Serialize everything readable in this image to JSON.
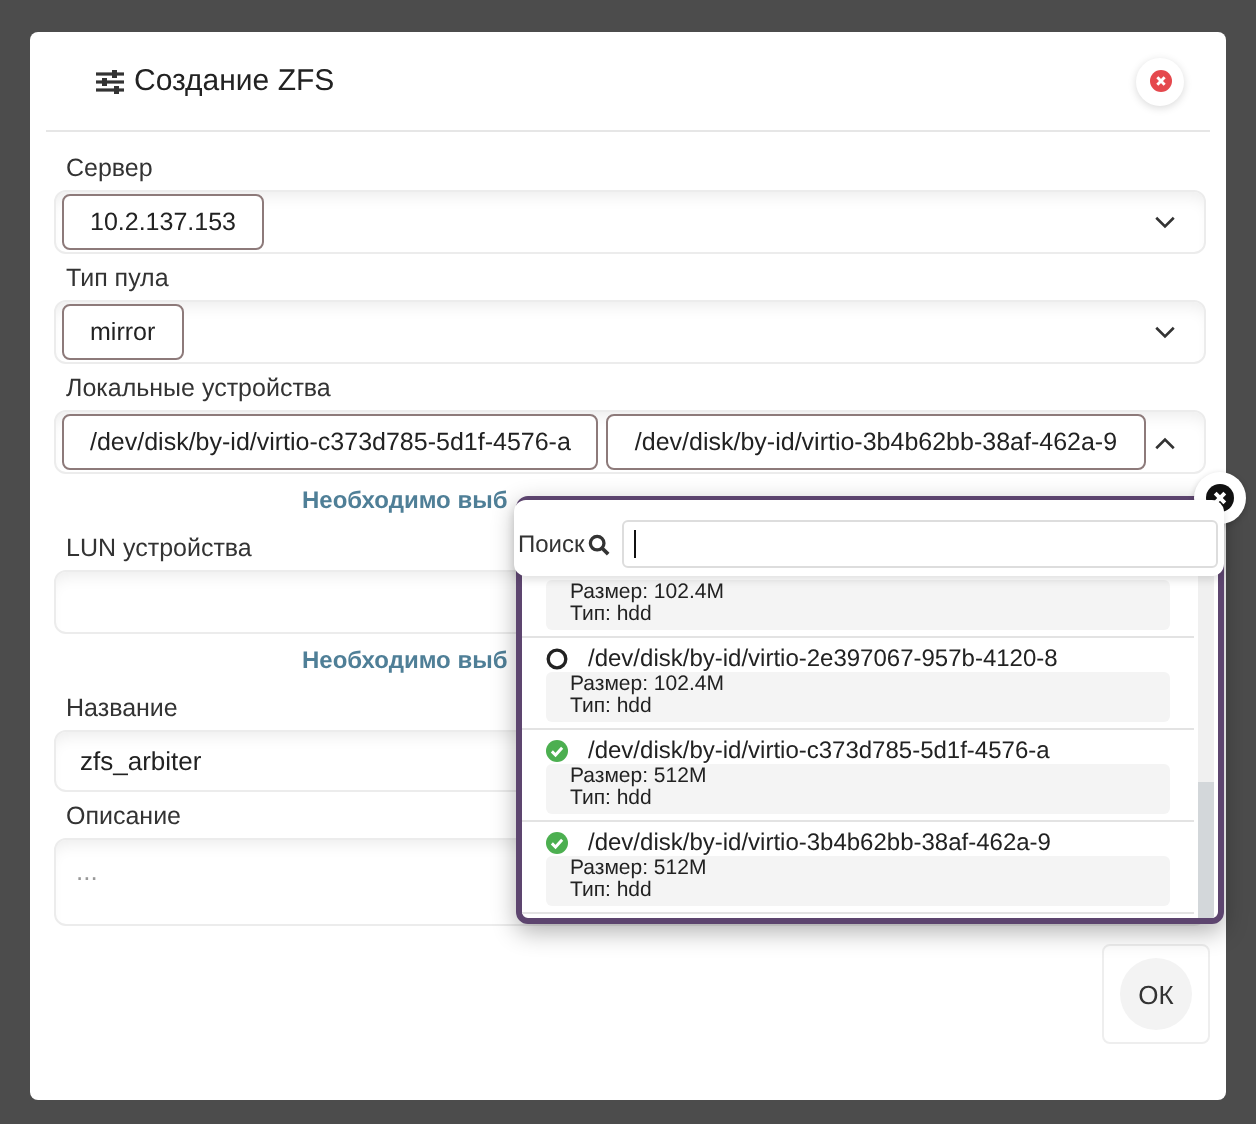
{
  "dialog": {
    "title": "Создание ZFS"
  },
  "fields": [
    {
      "kind": "select",
      "label": "Сервер",
      "chips": [
        "10.2.137.153"
      ],
      "expanded": false
    },
    {
      "kind": "select",
      "label": "Тип пула",
      "chips": [
        "mirror"
      ],
      "expanded": false
    },
    {
      "kind": "select",
      "label": "Локальные устройства",
      "chips": [
        "/dev/disk/by-id/virtio-c373d785-5d1f-4576-a",
        "/dev/disk/by-id/virtio-3b4b62bb-38af-462a-9"
      ],
      "expanded": true,
      "hint": "Необходимо выб"
    },
    {
      "kind": "select",
      "label": "LUN устройства",
      "hint": "Необходимо выб"
    },
    {
      "kind": "text",
      "label": "Название",
      "value": "zfs_arbiter"
    },
    {
      "kind": "textarea",
      "label": "Описание",
      "placeholder": "..."
    }
  ],
  "dropdown": {
    "search_label": "Поиск",
    "items": [
      {
        "size": "Размер: 102.4M",
        "type": "Тип: hdd"
      },
      {
        "path": "/dev/disk/by-id/virtio-2e397067-957b-4120-8",
        "size": "Размер: 102.4M",
        "type": "Тип: hdd",
        "selected": false
      },
      {
        "path": "/dev/disk/by-id/virtio-c373d785-5d1f-4576-a",
        "size": "Размер: 512M",
        "type": "Тип: hdd",
        "selected": true
      },
      {
        "path": "/dev/disk/by-id/virtio-3b4b62bb-38af-462a-9",
        "size": "Размер: 512M",
        "type": "Тип: hdd",
        "selected": true
      }
    ]
  },
  "ok_button": "ОК"
}
